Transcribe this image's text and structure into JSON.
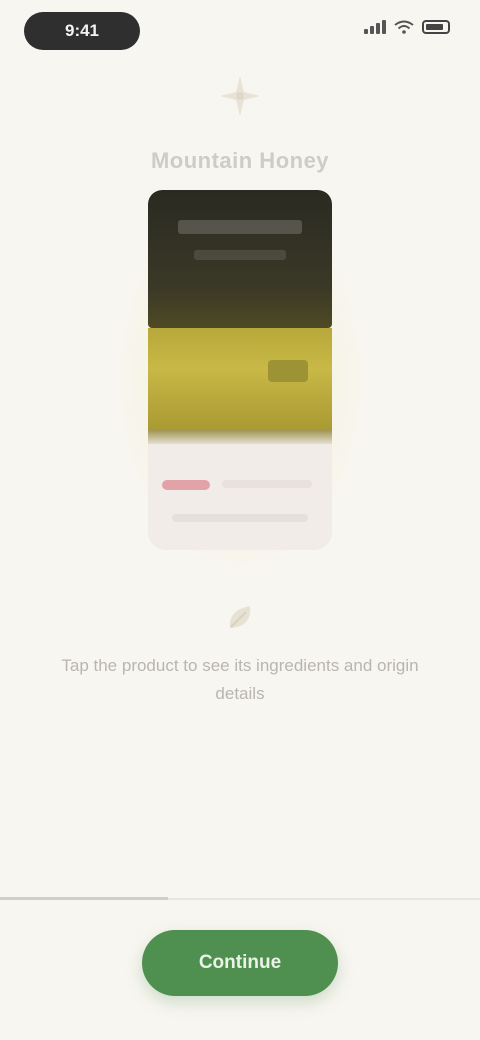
{
  "status_bar": {
    "time": "9:41"
  },
  "header": {
    "icon": "sparkle-icon",
    "title": "Mountain Honey"
  },
  "product": {
    "image_icon": "honey-jar-image",
    "colors": {
      "cap": "#2f2e24",
      "band": "#c0b041",
      "label": "#f1ece7",
      "accent": "#e2a3a8"
    }
  },
  "info": {
    "icon": "leaf-icon",
    "text": "Tap the product to see its ingredients and origin details"
  },
  "bottom": {
    "progress_fraction": 0.35,
    "cta_label": "Continue"
  },
  "colors": {
    "background": "#f8f6f1",
    "accent": "#4f8f50"
  }
}
